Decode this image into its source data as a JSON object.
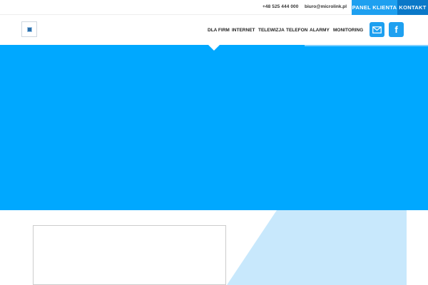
{
  "topbar": {
    "phone": "+48 525 444 000",
    "email": "biuro@microlink.pl",
    "panel_button": "PANEL KLIENTA",
    "contact_button": "KONTAKT"
  },
  "nav": {
    "items": [
      {
        "label": "DLA FIRM"
      },
      {
        "label": "INTERNET"
      },
      {
        "label": "TELEWIZJA"
      },
      {
        "label": "TELEFON"
      },
      {
        "label": "ALARMY"
      },
      {
        "label": "MONITORING"
      }
    ]
  },
  "social": {
    "icons": [
      "mail-icon",
      "facebook-icon"
    ],
    "facebook_glyph": "f"
  },
  "colors": {
    "accent": "#1ea0f0",
    "accent_dark": "#0a78c8",
    "hero": "#00a8ff",
    "hero_light": "#c8e8fc"
  }
}
